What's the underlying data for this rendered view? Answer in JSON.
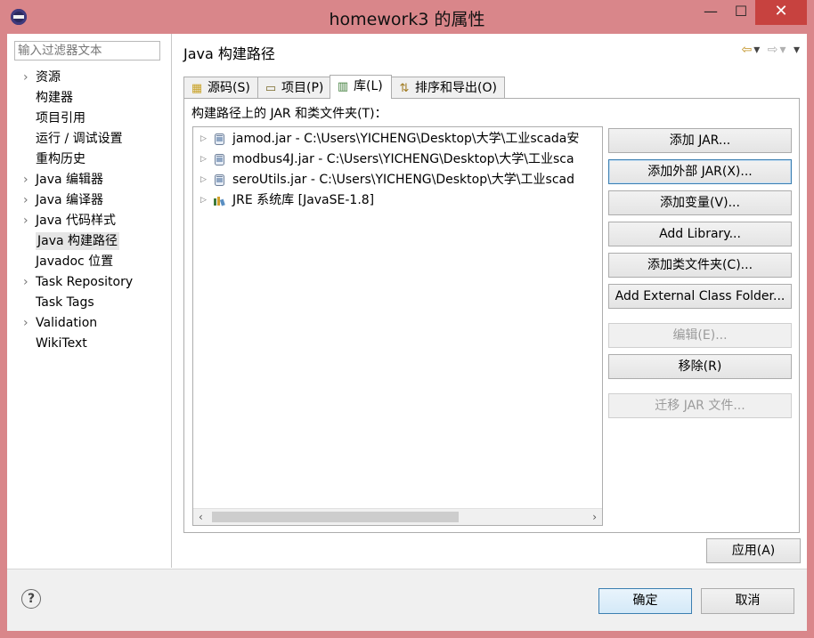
{
  "window": {
    "title": "homework3 的属性",
    "minimize": "—",
    "maximize": "☐",
    "close": "✕"
  },
  "filter": {
    "placeholder": "输入过滤器文本"
  },
  "nav": {
    "items": [
      {
        "label": "资源",
        "expandable": true
      },
      {
        "label": "构建器",
        "expandable": false
      },
      {
        "label": "项目引用",
        "expandable": false
      },
      {
        "label": "运行 / 调试设置",
        "expandable": false
      },
      {
        "label": "重构历史",
        "expandable": false
      },
      {
        "label": "Java 编辑器",
        "expandable": true
      },
      {
        "label": "Java 编译器",
        "expandable": true
      },
      {
        "label": "Java 代码样式",
        "expandable": true
      },
      {
        "label": "Java 构建路径",
        "expandable": false,
        "selected": true
      },
      {
        "label": "Javadoc 位置",
        "expandable": false
      },
      {
        "label": "Task Repository",
        "expandable": true
      },
      {
        "label": "Task Tags",
        "expandable": false
      },
      {
        "label": "Validation",
        "expandable": true
      },
      {
        "label": "WikiText",
        "expandable": false
      }
    ]
  },
  "page": {
    "title": "Java 构建路径",
    "tabs": [
      {
        "label": "源码(S)",
        "icon": "source-folder-icon"
      },
      {
        "label": "项目(P)",
        "icon": "project-icon"
      },
      {
        "label": "库(L)",
        "icon": "library-icon",
        "active": true
      },
      {
        "label": "排序和导出(O)",
        "icon": "order-export-icon"
      }
    ],
    "list_label": "构建路径上的 JAR 和类文件夹(T)：",
    "entries": [
      {
        "text": "jamod.jar - C:\\Users\\YICHENG\\Desktop\\大学\\工业scada安",
        "icon": "jar-icon"
      },
      {
        "text": "modbus4J.jar - C:\\Users\\YICHENG\\Desktop\\大学\\工业sca",
        "icon": "jar-icon"
      },
      {
        "text": "seroUtils.jar - C:\\Users\\YICHENG\\Desktop\\大学\\工业scad",
        "icon": "jar-icon"
      },
      {
        "text": "JRE 系统库 [JavaSE-1.8]",
        "icon": "jre-library-icon"
      }
    ],
    "buttons": {
      "add_jar": "添加 JAR...",
      "add_external_jar": "添加外部 JAR(X)...",
      "add_variable": "添加变量(V)...",
      "add_library": "Add Library...",
      "add_class_folder": "添加类文件夹(C)...",
      "add_external_class_folder": "Add External Class Folder...",
      "edit": "编辑(E)...",
      "remove": "移除(R)",
      "migrate_jar": "迁移 JAR 文件..."
    },
    "apply": "应用(A)"
  },
  "footer": {
    "help": "?",
    "ok": "确定",
    "cancel": "取消"
  },
  "colors": {
    "window_frame": "#d9868a",
    "close_button": "#c7423f",
    "focus_border": "#3c7fb1"
  }
}
